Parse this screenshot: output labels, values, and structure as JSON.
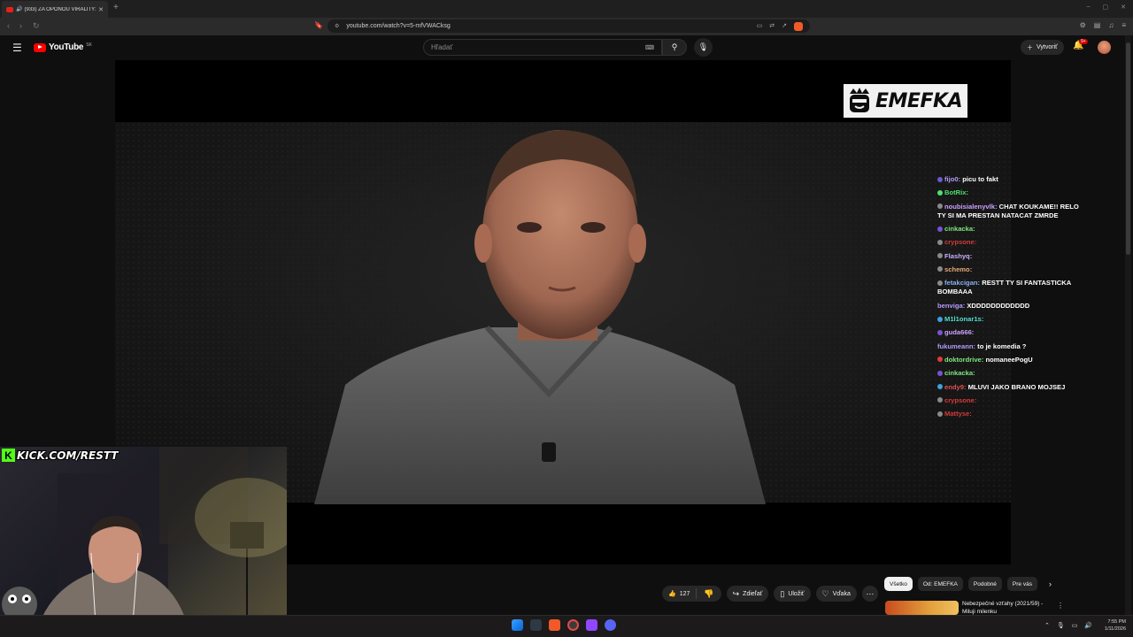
{
  "browser": {
    "tab_title": "(933) ZA OPONOU VIRALITY:",
    "new_tab": "+",
    "url": "youtube.com/watch?v=5-mfVWACksg",
    "window_controls": [
      "–",
      "▢",
      "✕"
    ]
  },
  "youtube": {
    "logo_word": "YouTube",
    "logo_country": "SK",
    "search_placeholder": "Hľadať",
    "create_label": "Vytvoriť",
    "notifications_badge": "9+"
  },
  "video": {
    "brand_logo": "EMEFKA",
    "webcam_logo": "KICK.COM/RESTT"
  },
  "chat": [
    {
      "user": "fijo0:",
      "text": "picu to fakt",
      "color": "#b49cff",
      "badge": "#6a5acd"
    },
    {
      "user": "BotRix:",
      "text": "",
      "color": "#4de070",
      "badge": "#4de070"
    },
    {
      "user": "noubisialenyvlk:",
      "text": "CHAT KOUKAME!! RELO TY SI MA PRESTAN NATACAT ZMRDE",
      "color": "#c9a2ff",
      "badge": "#8a8a8a"
    },
    {
      "user": "cinkacka:",
      "text": "",
      "color": "#7ee87e",
      "badge": "#7a52d4"
    },
    {
      "user": "crypsone:",
      "text": "",
      "color": "#d43a3a",
      "badge": "#8a8a8a"
    },
    {
      "user": "Flashyq:",
      "text": "",
      "color": "#c7b2ff",
      "badge": "#8a8a8a"
    },
    {
      "user": "schemo:",
      "text": "",
      "color": "#e8a87a",
      "badge": "#8a8a8a"
    },
    {
      "user": "fetakcigan:",
      "text": "RESTT TY SI FANTASTICKA BOMBAAA",
      "color": "#8aaef0",
      "badge": "#8a8a8a"
    },
    {
      "user": "benviga:",
      "text": "XDDDDDDDDDDDD",
      "color": "#b49cff",
      "badge": ""
    },
    {
      "user": "M1l1onar1s:",
      "text": "",
      "color": "#4de0d0",
      "badge": "#3fa0e0"
    },
    {
      "user": "guda666:",
      "text": "",
      "color": "#c9a2ff",
      "badge": "#7a52d4"
    },
    {
      "user": "fukumeann:",
      "text": "to je komedia ?",
      "color": "#b49cff",
      "badge": ""
    },
    {
      "user": "doktordrive:",
      "text": "nomaneePogU",
      "color": "#7ee87e",
      "badge": "#e23b3b"
    },
    {
      "user": "cinkacka:",
      "text": "",
      "color": "#7ee87e",
      "badge": "#7a52d4"
    },
    {
      "user": "endy9:",
      "text": "MLUVI JAKO BRANO MOJSEJ",
      "color": "#e05050",
      "badge": "#3fa0e0"
    },
    {
      "user": "crypsone:",
      "text": "",
      "color": "#d43a3a",
      "badge": "#8a8a8a"
    },
    {
      "user": "Mattyse:",
      "text": "",
      "color": "#d43a3a",
      "badge": "#8a8a8a"
    }
  ],
  "actions": {
    "like_count": "127",
    "share": "Zdieľať",
    "save": "Uložiť",
    "thanks": "Vďaka"
  },
  "chips": [
    "Všetko",
    "Od: EMEFKA",
    "Podobné",
    "Pre vás"
  ],
  "recommended": {
    "title": "Nebezpečné vzťahy (2021/59) - Miluji milenku"
  },
  "taskbar": {
    "time": "7:55 PM",
    "date": "1/11/2026"
  }
}
